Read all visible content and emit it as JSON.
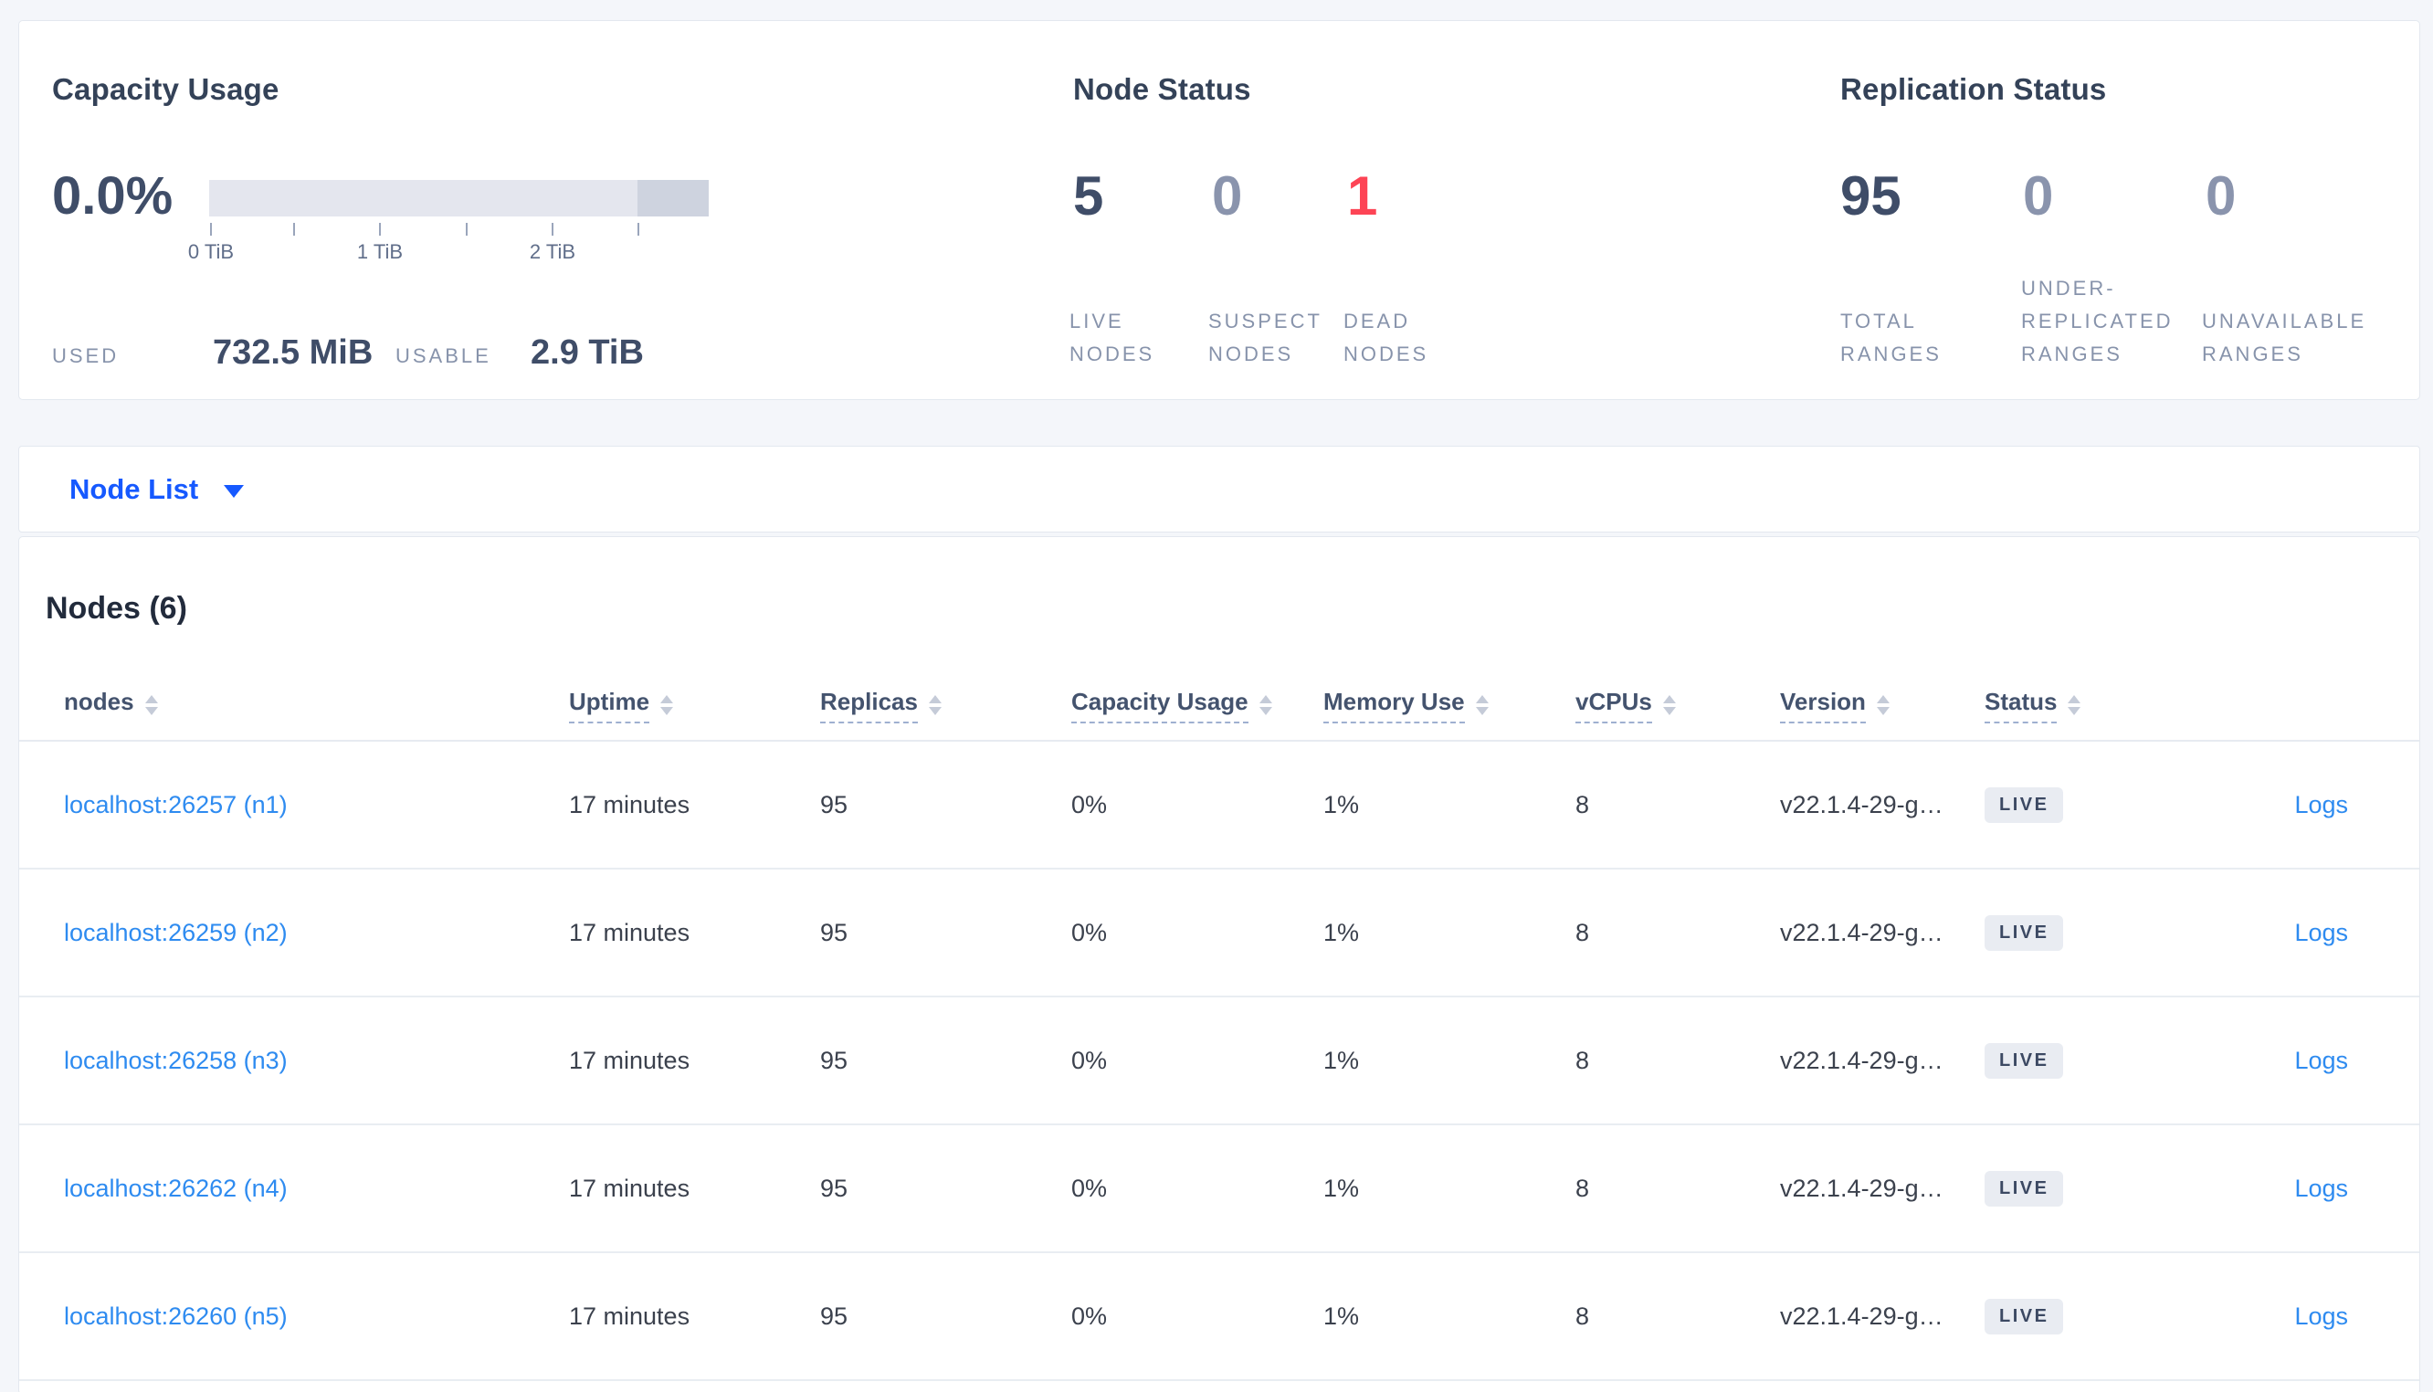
{
  "colors": {
    "page_bg": "#f4f6fa",
    "accent_blue": "#1659ff",
    "link_blue": "#2e8bf0",
    "stat_dark": "#3f4d68",
    "stat_muted": "#8a94ad",
    "stat_red": "#fd4455",
    "label_gray": "#8793ab",
    "badge_bg": "#e9ecf2"
  },
  "summary": {
    "capacity": {
      "title": "Capacity Usage",
      "percent": "0.0%",
      "ticks": [
        "0 TiB",
        "1 TiB",
        "2 TiB"
      ],
      "used_label": "USED",
      "used_value": "732.5 MiB",
      "usable_label": "USABLE",
      "usable_value": "2.9 TiB"
    },
    "node_status": {
      "title": "Node Status",
      "stats": [
        {
          "value": "5",
          "label": "LIVE NODES",
          "tone": "dark"
        },
        {
          "value": "0",
          "label": "SUSPECT NODES",
          "tone": "muted"
        },
        {
          "value": "1",
          "label": "DEAD NODES",
          "tone": "red"
        }
      ]
    },
    "replication": {
      "title": "Replication Status",
      "stats": [
        {
          "value": "95",
          "label": "TOTAL RANGES",
          "tone": "dark"
        },
        {
          "value": "0",
          "label": "UNDER-REPLICATED RANGES",
          "tone": "muted"
        },
        {
          "value": "0",
          "label": "UNAVAILABLE RANGES",
          "tone": "muted"
        }
      ]
    }
  },
  "view_selector": {
    "label": "Node List"
  },
  "table": {
    "title": "Nodes (6)",
    "columns": [
      {
        "label": "nodes",
        "underline": false
      },
      {
        "label": "Uptime",
        "underline": true
      },
      {
        "label": "Replicas",
        "underline": true
      },
      {
        "label": "Capacity Usage",
        "underline": true
      },
      {
        "label": "Memory Use",
        "underline": true
      },
      {
        "label": "vCPUs",
        "underline": true
      },
      {
        "label": "Version",
        "underline": true
      },
      {
        "label": "Status",
        "underline": true
      }
    ],
    "rows": [
      {
        "node": "localhost:26257 (n1)",
        "uptime": "17 minutes",
        "replicas": "95",
        "capacity": "0%",
        "memory": "1%",
        "vcpus": "8",
        "version": "v22.1.4-29-g…",
        "status": "LIVE",
        "logs": "Logs"
      },
      {
        "node": "localhost:26259 (n2)",
        "uptime": "17 minutes",
        "replicas": "95",
        "capacity": "0%",
        "memory": "1%",
        "vcpus": "8",
        "version": "v22.1.4-29-g…",
        "status": "LIVE",
        "logs": "Logs"
      },
      {
        "node": "localhost:26258 (n3)",
        "uptime": "17 minutes",
        "replicas": "95",
        "capacity": "0%",
        "memory": "1%",
        "vcpus": "8",
        "version": "v22.1.4-29-g…",
        "status": "LIVE",
        "logs": "Logs"
      },
      {
        "node": "localhost:26262 (n4)",
        "uptime": "17 minutes",
        "replicas": "95",
        "capacity": "0%",
        "memory": "1%",
        "vcpus": "8",
        "version": "v22.1.4-29-g…",
        "status": "LIVE",
        "logs": "Logs"
      },
      {
        "node": "localhost:26260 (n5)",
        "uptime": "17 minutes",
        "replicas": "95",
        "capacity": "0%",
        "memory": "1%",
        "vcpus": "8",
        "version": "v22.1.4-29-g…",
        "status": "LIVE",
        "logs": "Logs"
      }
    ]
  }
}
